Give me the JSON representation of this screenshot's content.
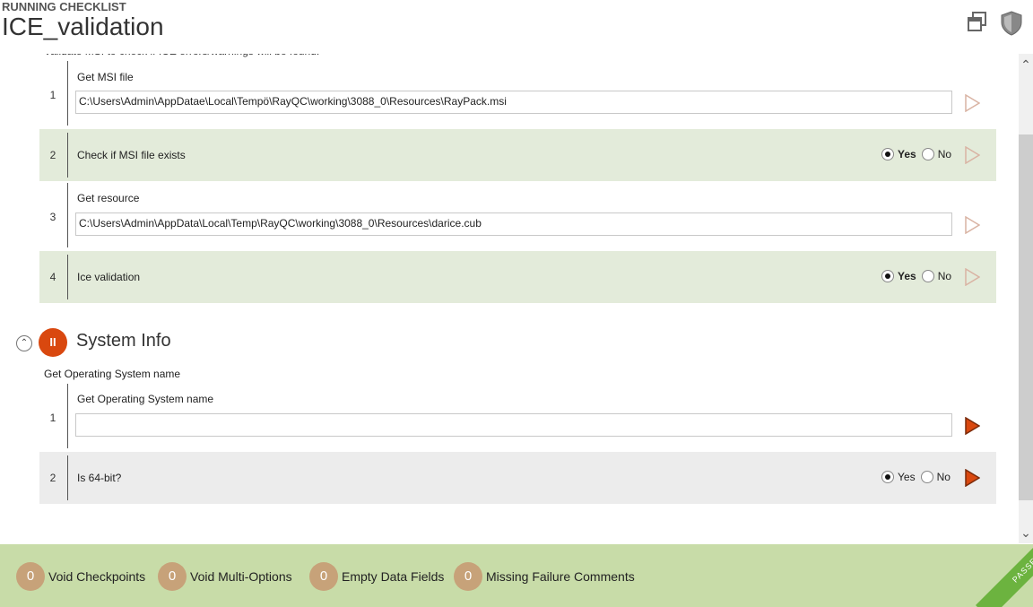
{
  "header": {
    "section_label": "RUNNING CHECKLIST",
    "title": "ICE_validation",
    "icons": [
      "windows-icon",
      "shield-icon"
    ]
  },
  "checklist": {
    "top_description": "Validate MSI to check if ICE errors/warnings will be found.",
    "steps": [
      {
        "number": "1",
        "label": "Get MSI file",
        "value": "C:\\Users\\Admin\\AppDatae\\Local\\Tempö\\RayQC\\working\\3088_0\\Resources\\RayPack.msi"
      },
      {
        "number": "2",
        "label": "Check if MSI file exists",
        "yes": "Yes",
        "no": "No",
        "selected": "Yes"
      },
      {
        "number": "3",
        "label": "Get resource",
        "value": "C:\\Users\\Admin\\AppData\\Local\\Temp\\RayQC\\working\\3088_0\\Resources\\darice.cub"
      },
      {
        "number": "4",
        "label": "Ice validation",
        "yes": "Yes",
        "no": "No",
        "selected": "Yes"
      }
    ]
  },
  "system_info": {
    "badge": "II",
    "title": "System Info",
    "description": "Get Operating System name",
    "steps": [
      {
        "number": "1",
        "label": "Get Operating System name",
        "value": ""
      },
      {
        "number": "2",
        "label": "Is 64-bit?",
        "yes": "Yes",
        "no": "No",
        "selected": "Yes"
      }
    ]
  },
  "footer": {
    "stats": [
      {
        "count": "0",
        "label": "Void Checkpoints"
      },
      {
        "count": "0",
        "label": "Void Multi-Options"
      },
      {
        "count": "0",
        "label": "Empty Data Fields"
      },
      {
        "count": "0",
        "label": "Missing Failure Comments"
      }
    ],
    "status": "PASSED"
  },
  "colors": {
    "accent": "#d9480f",
    "footer_bg": "#c8dca8",
    "passed": "#6cb33f",
    "row_green": "#e3ebda",
    "row_grey": "#ececec",
    "badge": "#c7a279"
  }
}
